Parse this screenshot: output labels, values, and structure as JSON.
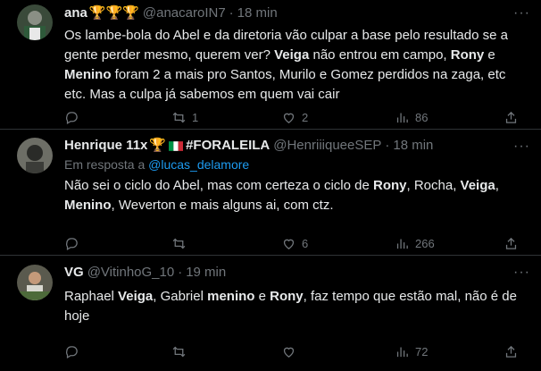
{
  "tweets": [
    {
      "name": "ana",
      "emojis": "🏆🏆🏆",
      "handle": "@anacaroIN7",
      "time": "18 min",
      "replying_to_label": "",
      "replying_to": "",
      "text_parts": [
        {
          "t": "Os lambe-bola do Abel e da diretoria vão culpar a base pelo resultado se a gente perder mesmo, querem ver? ",
          "b": false
        },
        {
          "t": "Veiga",
          "b": true
        },
        {
          "t": " não entrou em campo, ",
          "b": false
        },
        {
          "t": "Rony",
          "b": true
        },
        {
          "t": " e ",
          "b": false
        },
        {
          "t": "Menino",
          "b": true
        },
        {
          "t": " foram 2 a mais pro Santos, Murilo e Gomez perdidos na zaga, etc etc. Mas a culpa já sabemos em quem vai cair",
          "b": false
        }
      ],
      "replies": "",
      "retweets": "1",
      "likes": "2",
      "views": "86"
    },
    {
      "name": "Henrique 11x",
      "name_suffix": "#FORALEILA",
      "emojis": "🏆",
      "handle": "@HenriiiqueeSEP",
      "time": "18 min",
      "replying_to_label": "Em resposta a",
      "replying_to": "@lucas_delamore",
      "text_parts": [
        {
          "t": "Não sei o ciclo do Abel, mas com certeza o ciclo de ",
          "b": false
        },
        {
          "t": "Rony",
          "b": true
        },
        {
          "t": ", Rocha, ",
          "b": false
        },
        {
          "t": "Veiga",
          "b": true
        },
        {
          "t": ", ",
          "b": false
        },
        {
          "t": "Menino",
          "b": true
        },
        {
          "t": ", Weverton e mais alguns ai, com ctz.",
          "b": false
        }
      ],
      "replies": "",
      "retweets": "",
      "likes": "6",
      "views": "266"
    },
    {
      "name": "VG",
      "handle": "@VitinhoG_10",
      "time": "19 min",
      "replying_to_label": "",
      "replying_to": "",
      "text_parts": [
        {
          "t": "Raphael ",
          "b": false
        },
        {
          "t": "Veiga",
          "b": true
        },
        {
          "t": ", Gabriel ",
          "b": false
        },
        {
          "t": "menino",
          "b": true
        },
        {
          "t": " e ",
          "b": false
        },
        {
          "t": "Rony",
          "b": true
        },
        {
          "t": ", faz tempo que estão mal, não é de hoje",
          "b": false
        }
      ],
      "replies": "",
      "retweets": "",
      "likes": "",
      "views": "72"
    }
  ],
  "separator": "·",
  "icons": [
    "more-icon",
    "reply-icon",
    "retweet-icon",
    "like-icon",
    "views-icon",
    "share-icon"
  ],
  "colors": {
    "background": "#000000",
    "text": "#e7e9ea",
    "muted": "#71767b",
    "link": "#1d9bf0",
    "border": "#2f3336"
  }
}
